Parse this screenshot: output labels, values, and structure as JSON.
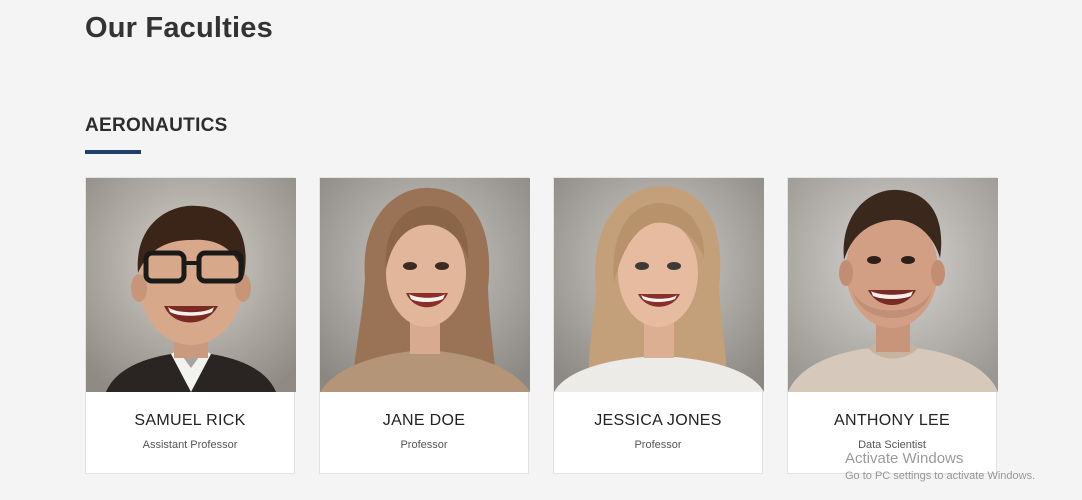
{
  "page": {
    "title": "Our Faculties"
  },
  "section": {
    "title": "AERONAUTICS",
    "accent_color": "#1f3e72"
  },
  "faculty": [
    {
      "name": "SAMUEL RICK",
      "role": "Assistant Professor",
      "photo": "portrait-photo"
    },
    {
      "name": "JANE DOE",
      "role": "Professor",
      "photo": "portrait-photo"
    },
    {
      "name": "JESSICA JONES",
      "role": "Professor",
      "photo": "portrait-photo"
    },
    {
      "name": "ANTHONY LEE",
      "role": "Data Scientist",
      "photo": "portrait-photo"
    }
  ],
  "watermark": {
    "title": "Activate Windows",
    "subtitle": "Go to PC settings to activate Windows."
  }
}
